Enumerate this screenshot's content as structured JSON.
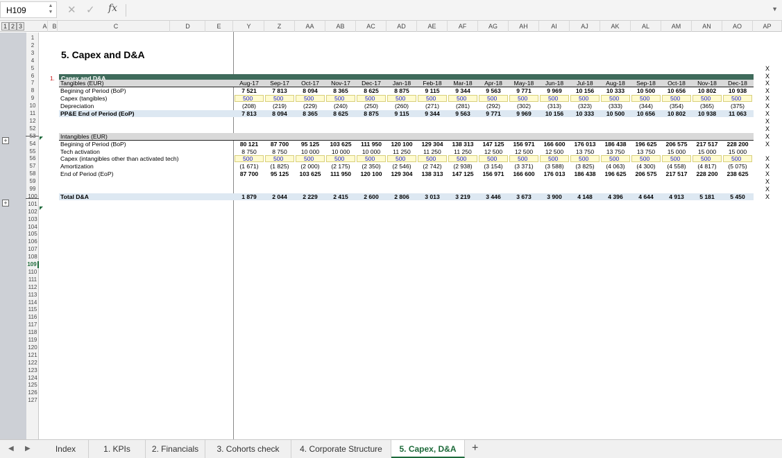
{
  "formula_bar": {
    "cell_ref": "H109",
    "formula": ""
  },
  "outline_levels": [
    "1",
    "2",
    "3"
  ],
  "columns": [
    "A",
    "B",
    "C",
    "D",
    "E",
    "Y",
    "Z",
    "AA",
    "AB",
    "AC",
    "AD",
    "AE",
    "AF",
    "AG",
    "AH",
    "AI",
    "AJ",
    "AK",
    "AL",
    "AM",
    "AN",
    "AO",
    "AP"
  ],
  "row_numbers": [
    "1",
    "2",
    "3",
    "4",
    "5",
    "6",
    "7",
    "8",
    "9",
    "10",
    "11",
    "12",
    "52",
    "53",
    "54",
    "55",
    "56",
    "57",
    "58",
    "59",
    "99",
    "100",
    "101",
    "102",
    "103",
    "104",
    "105",
    "106",
    "107",
    "108",
    "109",
    "110",
    "111",
    "112",
    "113",
    "114",
    "115",
    "116",
    "117",
    "118",
    "119",
    "120",
    "121",
    "122",
    "123",
    "124",
    "125",
    "126",
    "127"
  ],
  "active_row": "109",
  "sheet": {
    "title": "5. Capex and D&A",
    "section_number": "1.",
    "section_title": "Capex and D&A",
    "months": [
      "Aug-17",
      "Sep-17",
      "Oct-17",
      "Nov-17",
      "Dec-17",
      "Jan-18",
      "Feb-18",
      "Mar-18",
      "Apr-18",
      "May-18",
      "Jun-18",
      "Jul-18",
      "Aug-18",
      "Sep-18",
      "Oct-18",
      "Nov-18",
      "Dec-18"
    ],
    "tangibles": {
      "header": "Tangibles (EUR)",
      "rows": [
        {
          "label": "Begining of Period (BoP)",
          "style": "bold",
          "values": [
            "7 521",
            "7 813",
            "8 094",
            "8 365",
            "8 625",
            "8 875",
            "9 115",
            "9 344",
            "9 563",
            "9 771",
            "9 969",
            "10 156",
            "10 333",
            "10 500",
            "10 656",
            "10 802",
            "10 938"
          ]
        },
        {
          "label": "Capex (tangibles)",
          "style": "input",
          "values": [
            "500",
            "500",
            "500",
            "500",
            "500",
            "500",
            "500",
            "500",
            "500",
            "500",
            "500",
            "500",
            "500",
            "500",
            "500",
            "500",
            "500"
          ]
        },
        {
          "label": "Depreciation",
          "style": "normal",
          "values": [
            "(208)",
            "(219)",
            "(229)",
            "(240)",
            "(250)",
            "(260)",
            "(271)",
            "(281)",
            "(292)",
            "(302)",
            "(313)",
            "(323)",
            "(333)",
            "(344)",
            "(354)",
            "(365)",
            "(375)"
          ]
        },
        {
          "label": "PP&E End of Period (EoP)",
          "style": "total",
          "values": [
            "7 813",
            "8 094",
            "8 365",
            "8 625",
            "8 875",
            "9 115",
            "9 344",
            "9 563",
            "9 771",
            "9 969",
            "10 156",
            "10 333",
            "10 500",
            "10 656",
            "10 802",
            "10 938",
            "11 063"
          ]
        }
      ]
    },
    "intangibles": {
      "header": "Intangibles (EUR)",
      "rows": [
        {
          "label": "Begining of Period (BoP)",
          "style": "bold",
          "values": [
            "80 121",
            "87 700",
            "95 125",
            "103 625",
            "111 950",
            "120 100",
            "129 304",
            "138 313",
            "147 125",
            "156 971",
            "166 600",
            "176 013",
            "186 438",
            "196 625",
            "206 575",
            "217 517",
            "228 200"
          ]
        },
        {
          "label": "Tech activation",
          "style": "normal",
          "values": [
            "8 750",
            "8 750",
            "10 000",
            "10 000",
            "10 000",
            "11 250",
            "11 250",
            "11 250",
            "12 500",
            "12 500",
            "12 500",
            "13 750",
            "13 750",
            "13 750",
            "15 000",
            "15 000",
            "15 000"
          ]
        },
        {
          "label": "Capex (intangibles other than activated tech)",
          "style": "input",
          "values": [
            "500",
            "500",
            "500",
            "500",
            "500",
            "500",
            "500",
            "500",
            "500",
            "500",
            "500",
            "500",
            "500",
            "500",
            "500",
            "500",
            "500"
          ]
        },
        {
          "label": "Amortization",
          "style": "normal",
          "values": [
            "(1 671)",
            "(1 825)",
            "(2 000)",
            "(2 175)",
            "(2 350)",
            "(2 546)",
            "(2 742)",
            "(2 938)",
            "(3 154)",
            "(3 371)",
            "(3 588)",
            "(3 825)",
            "(4 063)",
            "(4 300)",
            "(4 558)",
            "(4 817)",
            "(5 075)"
          ]
        },
        {
          "label": "End of Period (EoP)",
          "style": "bold",
          "values": [
            "87 700",
            "95 125",
            "103 625",
            "111 950",
            "120 100",
            "129 304",
            "138 313",
            "147 125",
            "156 971",
            "166 600",
            "176 013",
            "186 438",
            "196 625",
            "206 575",
            "217 517",
            "228 200",
            "238 625"
          ]
        }
      ]
    },
    "total": {
      "label": "Total D&A",
      "values": [
        "1 879",
        "2 044",
        "2 229",
        "2 415",
        "2 600",
        "2 806",
        "3 013",
        "3 219",
        "3 446",
        "3 673",
        "3 900",
        "4 148",
        "4 396",
        "4 644",
        "4 913",
        "5 181",
        "5 450"
      ]
    },
    "x_marker": "X"
  },
  "tabs": [
    "Index",
    "1. KPIs",
    "2. Financials",
    "3. Cohorts check",
    "4. Corporate Structure",
    "5. Capex, D&A"
  ],
  "active_tab": "5. Capex, D&A",
  "add_sheet": "+"
}
